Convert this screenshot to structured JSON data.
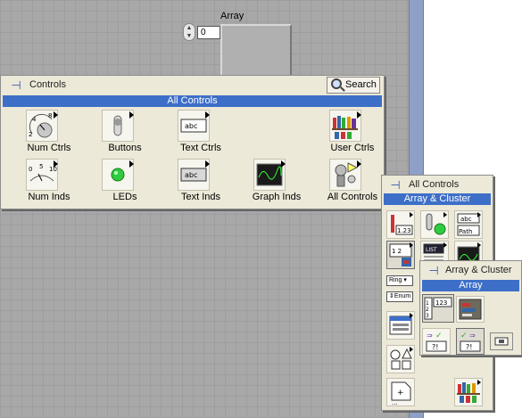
{
  "canvas": {
    "array_label": "Array",
    "array_index_value": "0"
  },
  "controls_palette": {
    "title": "Controls",
    "search_label": "Search",
    "category": "All Controls",
    "items": [
      {
        "label": "Num Ctrls",
        "icon": "knob-gauge-icon"
      },
      {
        "label": "Buttons",
        "icon": "toggle-switch-icon"
      },
      {
        "label": "Text Ctrls",
        "icon": "text-control-icon"
      },
      {
        "label": "User Ctrls",
        "icon": "bookshelf-icon"
      },
      {
        "label": "Num Inds",
        "icon": "slide-gauge-icon"
      },
      {
        "label": "LEDs",
        "icon": "led-icon"
      },
      {
        "label": "Text Inds",
        "icon": "text-indicator-icon"
      },
      {
        "label": "Graph Inds",
        "icon": "graph-icon"
      },
      {
        "label": "All Controls",
        "icon": "all-controls-icon"
      }
    ]
  },
  "all_controls_palette": {
    "title": "All Controls",
    "category": "Array & Cluster",
    "mini_texts": {
      "numeric": "1.23",
      "string": "abc",
      "path": "Path",
      "list": "LIST",
      "ring": "Ring",
      "enum": "Enum"
    }
  },
  "array_cluster_palette": {
    "title": "Array & Cluster",
    "category": "Array",
    "mini_texts": {
      "array_numeric": "123"
    }
  },
  "colors": {
    "category_bar": "#3d6fc8",
    "palette_bg": "#ece9d8",
    "canvas_bg": "#a8a8a8"
  }
}
